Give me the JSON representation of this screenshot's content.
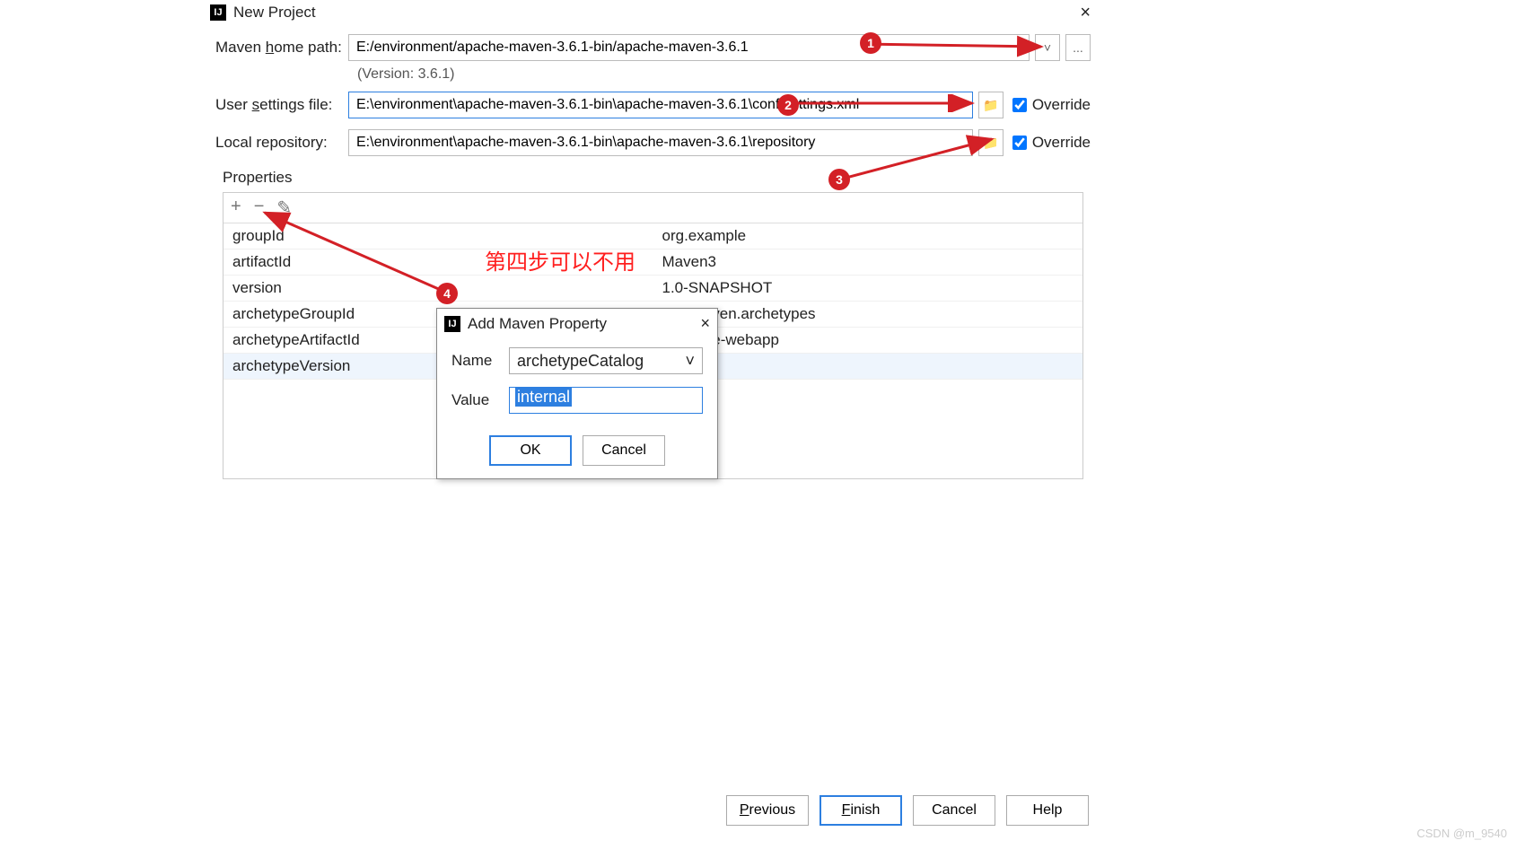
{
  "window": {
    "title": "New Project",
    "close_icon": "×"
  },
  "fields": {
    "maven_home": {
      "label_pre": "Maven ",
      "label_u": "h",
      "label_post": "ome path:",
      "value": "E:/environment/apache-maven-3.6.1-bin/apache-maven-3.6.1",
      "browse": "..."
    },
    "version_hint": "(Version: 3.6.1)",
    "user_settings": {
      "label_pre": "User ",
      "label_u": "s",
      "label_post": "ettings file:",
      "value": "E:\\environment\\apache-maven-3.6.1-bin\\apache-maven-3.6.1\\conf\\settings.xml",
      "override": "Override"
    },
    "local_repo": {
      "label": "Local repository:",
      "value": "E:\\environment\\apache-maven-3.6.1-bin\\apache-maven-3.6.1\\repository",
      "override": "Override"
    }
  },
  "properties": {
    "section": "Properties",
    "toolbar": {
      "add": "+",
      "remove": "−",
      "edit": "✎"
    },
    "rows": [
      {
        "k": "groupId",
        "v": "org.example"
      },
      {
        "k": "artifactId",
        "v": "Maven3"
      },
      {
        "k": "version",
        "v": "1.0-SNAPSHOT"
      },
      {
        "k": "archetypeGroupId",
        "v": "che.maven.archetypes"
      },
      {
        "k": "archetypeArtifactId",
        "v": "rchetype-webapp"
      },
      {
        "k": "archetypeVersion",
        "v": "-"
      }
    ]
  },
  "modal": {
    "title": "Add Maven Property",
    "close": "×",
    "name_label": "Name",
    "name_value": "archetypeCatalog",
    "value_label": "Value",
    "value_value": "internal",
    "ok": "OK",
    "cancel": "Cancel"
  },
  "footer": {
    "previous": "Previous",
    "finish": "Finish",
    "cancel": "Cancel",
    "help": "Help"
  },
  "annotations": {
    "note": "第四步可以不用",
    "b1": "1",
    "b2": "2",
    "b3": "3",
    "b4": "4"
  },
  "watermark": "CSDN @m_9540"
}
